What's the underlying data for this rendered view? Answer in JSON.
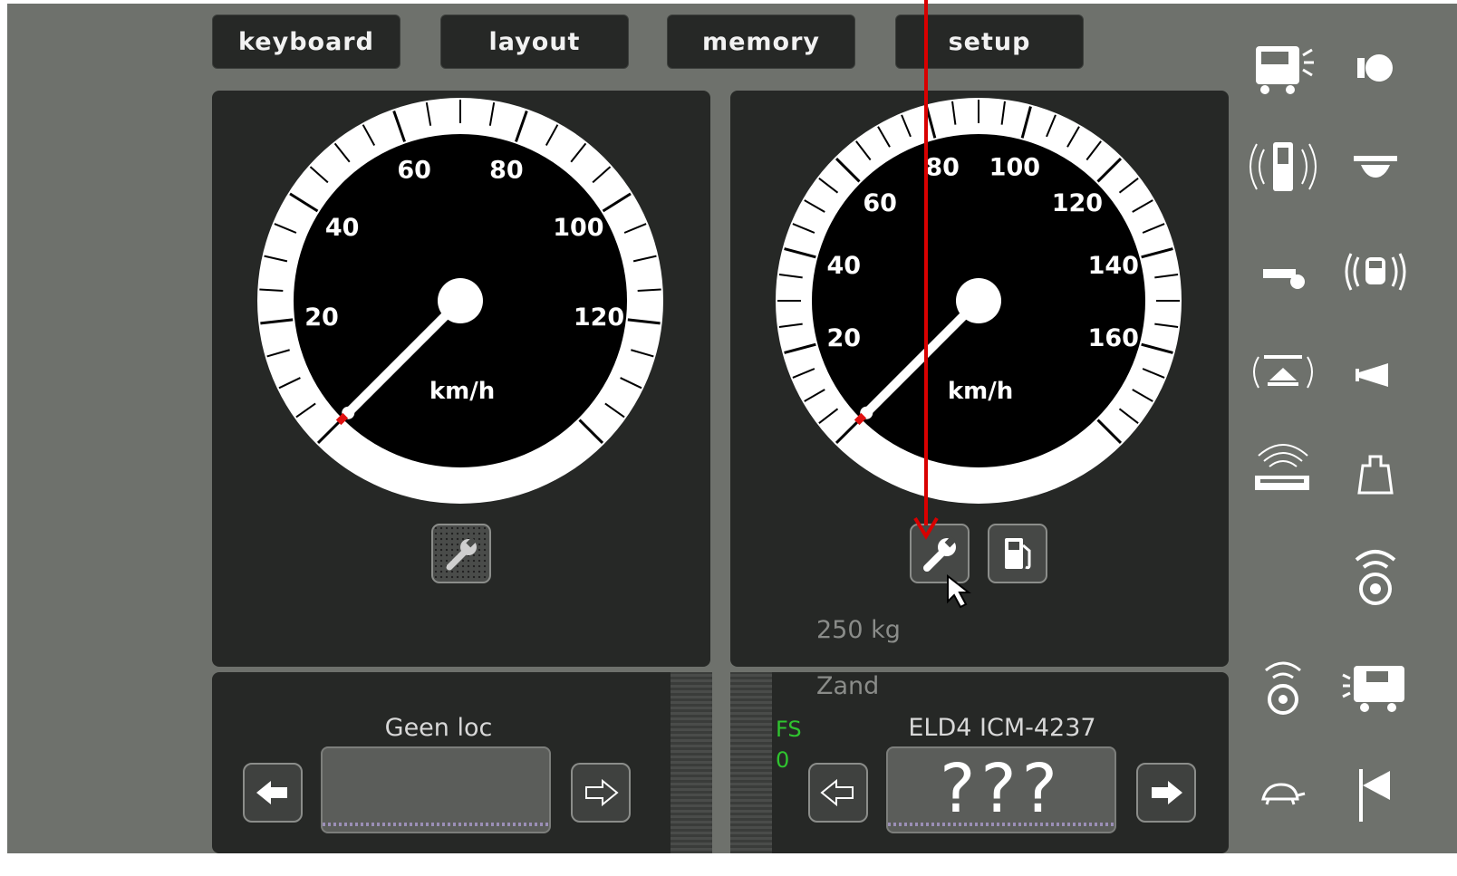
{
  "tabs": {
    "keyboard": "keyboard",
    "layout": "layout",
    "memory": "memory",
    "setup": "setup"
  },
  "left_gauge": {
    "unit": "km/h",
    "labels": [
      "20",
      "40",
      "60",
      "80",
      "100",
      "120"
    ],
    "speed": 0
  },
  "right_gauge": {
    "unit": "km/h",
    "labels": [
      "20",
      "40",
      "60",
      "80",
      "100",
      "120",
      "140",
      "160"
    ],
    "speed": 0
  },
  "right_info": {
    "weight": "250 kg",
    "sand_label": "Zand",
    "fs_label": "FS",
    "fs_value": "0"
  },
  "left_controller": {
    "loco_name": "Geen loc",
    "speed_display": ""
  },
  "right_controller": {
    "loco_name": "ELD4 ICM-4237",
    "speed_display": "???"
  },
  "colors": {
    "background": "#6e716c",
    "panel": "#262826",
    "needle_tip": "#e01010",
    "annotation_arrow": "#d90000",
    "fs_text": "#2fc42f"
  },
  "function_icons": [
    "cab-light-icon",
    "headlight-icon",
    "signal-radio-icon",
    "ceiling-light-icon",
    "whistle-icon",
    "radio-loco-icon",
    "coupler-sound-icon",
    "horn-icon",
    "station-announce-icon",
    "weight-icon",
    "wheel-sound-icon",
    "wheel-brake-sound-icon",
    "loco-side-icon",
    "shunting-turtle-icon",
    "flag-icon"
  ]
}
